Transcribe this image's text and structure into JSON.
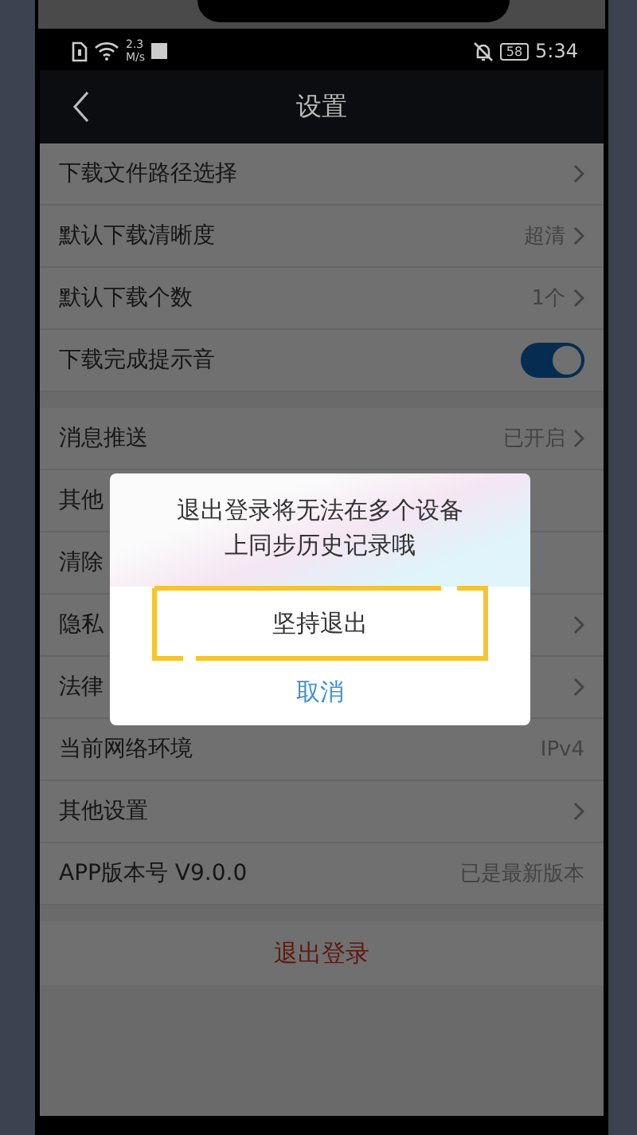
{
  "status_bar": {
    "speed_value": "2.3",
    "speed_unit": "M/s",
    "battery": "58",
    "time": "5:34"
  },
  "nav": {
    "title": "设置"
  },
  "groups": [
    {
      "rows": [
        {
          "kind": "arrow",
          "label": "下载文件路径选择"
        },
        {
          "kind": "arrow",
          "label": "默认下载清晰度",
          "value": "超清"
        },
        {
          "kind": "arrow",
          "label": "默认下载个数",
          "value": "1个"
        },
        {
          "kind": "toggle",
          "label": "下载完成提示音",
          "on": true
        }
      ]
    },
    {
      "rows": [
        {
          "kind": "arrow",
          "label": "消息推送",
          "value": "已开启"
        },
        {
          "kind": "plain",
          "label": "其他"
        },
        {
          "kind": "plain",
          "label": "清除"
        },
        {
          "kind": "arrow",
          "label": "隐私"
        },
        {
          "kind": "arrow",
          "label": "法律"
        },
        {
          "kind": "plain",
          "label": "当前网络环境",
          "value": "IPv4"
        },
        {
          "kind": "arrow",
          "label": "其他设置"
        },
        {
          "kind": "plain",
          "label": "APP版本号 V9.0.0",
          "value": "已是最新版本"
        }
      ]
    }
  ],
  "logout": "退出登录",
  "dialog": {
    "message": "退出登录将无法在多个设备上同步历史记录哦",
    "confirm": "坚持退出",
    "cancel": "取消"
  }
}
